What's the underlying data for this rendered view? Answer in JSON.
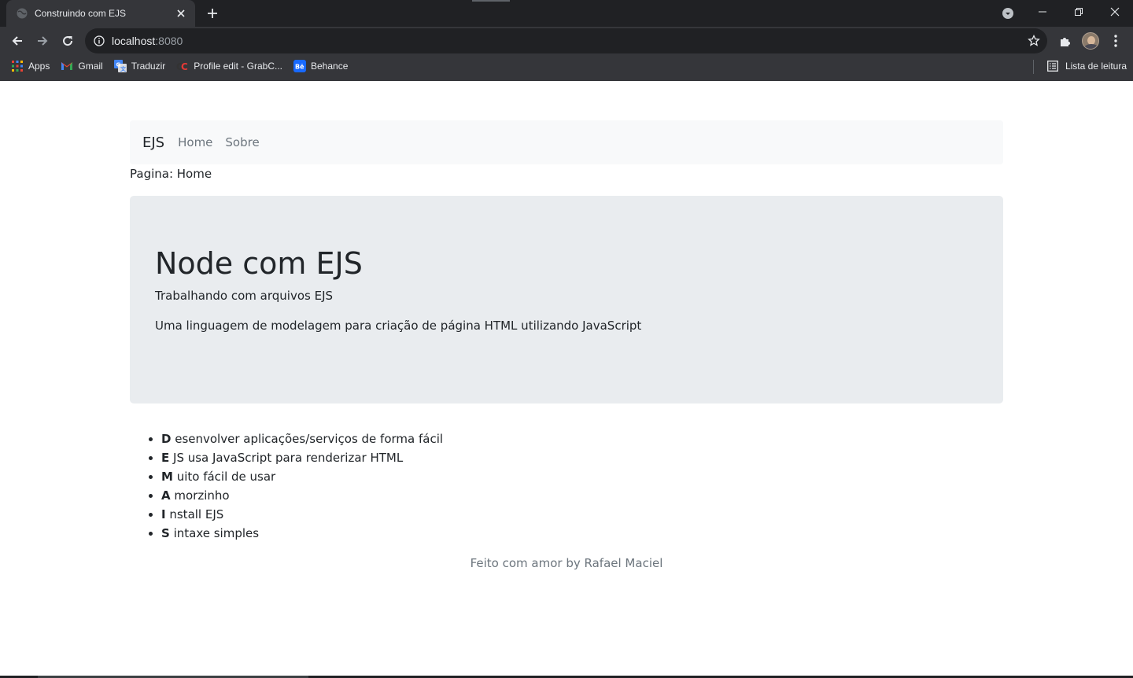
{
  "browser": {
    "tab": {
      "title": "Construindo com EJS"
    },
    "address": {
      "host": "localhost",
      "port": ":8080"
    },
    "bookmarks": [
      {
        "label": "Apps",
        "icon": "apps-grid-icon"
      },
      {
        "label": "Gmail",
        "icon": "gmail-icon"
      },
      {
        "label": "Traduzir",
        "icon": "translate-icon"
      },
      {
        "label": "Profile edit - GrabC...",
        "icon": "grabcad-icon"
      },
      {
        "label": "Behance",
        "icon": "behance-icon"
      }
    ],
    "reading_list": "Lista de leitura",
    "colors": {
      "chrome": "#35363a",
      "tabstrip": "#202124",
      "text": "#e8eaed"
    }
  },
  "navbar": {
    "brand": "EJS",
    "links": [
      "Home",
      "Sobre"
    ]
  },
  "pagina": "Pagina: Home",
  "jumbotron": {
    "title": "Node com EJS",
    "subtitle": "Trabalhando com arquivos EJS",
    "description": "Uma linguagem de modelagem para criação de página HTML utilizando JavaScript"
  },
  "features": [
    {
      "letter": "D",
      "rest": " esenvolver aplicações/serviços de forma fácil"
    },
    {
      "letter": "E",
      "rest": " JS usa JavaScript para renderizar HTML"
    },
    {
      "letter": "M",
      "rest": " uito fácil de usar"
    },
    {
      "letter": "A",
      "rest": " morzinho"
    },
    {
      "letter": "I",
      "rest": " nstall EJS"
    },
    {
      "letter": "S",
      "rest": " intaxe simples"
    }
  ],
  "footer": "Feito com amor by Rafael Maciel",
  "colors": {
    "navbar_bg": "#f8f9fa",
    "jumbotron_bg": "#e9ecef",
    "muted": "#6c757d",
    "text": "#212529"
  }
}
